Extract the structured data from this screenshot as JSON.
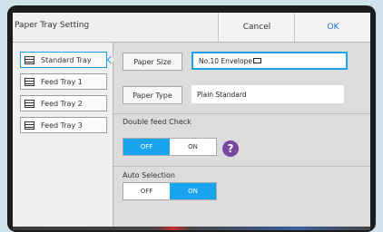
{
  "header": {
    "title": "Paper Tray Setting",
    "cancel_label": "Cancel",
    "ok_label": "OK"
  },
  "trays": [
    {
      "label": "Standard Tray",
      "selected": true
    },
    {
      "label": "Feed Tray 1",
      "selected": false
    },
    {
      "label": "Feed Tray 2",
      "selected": false
    },
    {
      "label": "Feed Tray 3",
      "selected": false
    }
  ],
  "paper_size": {
    "button_label": "Paper Size",
    "value": "No.10 Envelope"
  },
  "paper_type": {
    "button_label": "Paper Type",
    "value": "Plain Standard"
  },
  "double_feed_check": {
    "label": "Double feed Check",
    "off_label": "OFF",
    "on_label": "ON",
    "selected": "OFF",
    "help_glyph": "?"
  },
  "auto_selection": {
    "label": "Auto Selection",
    "off_label": "OFF",
    "on_label": "ON",
    "selected": "ON"
  },
  "colors": {
    "accent": "#18a4ee",
    "help": "#7a47a0"
  },
  "icons": [
    "tray-icon",
    "envelope-icon",
    "help-icon",
    "chevron-right-icon"
  ]
}
